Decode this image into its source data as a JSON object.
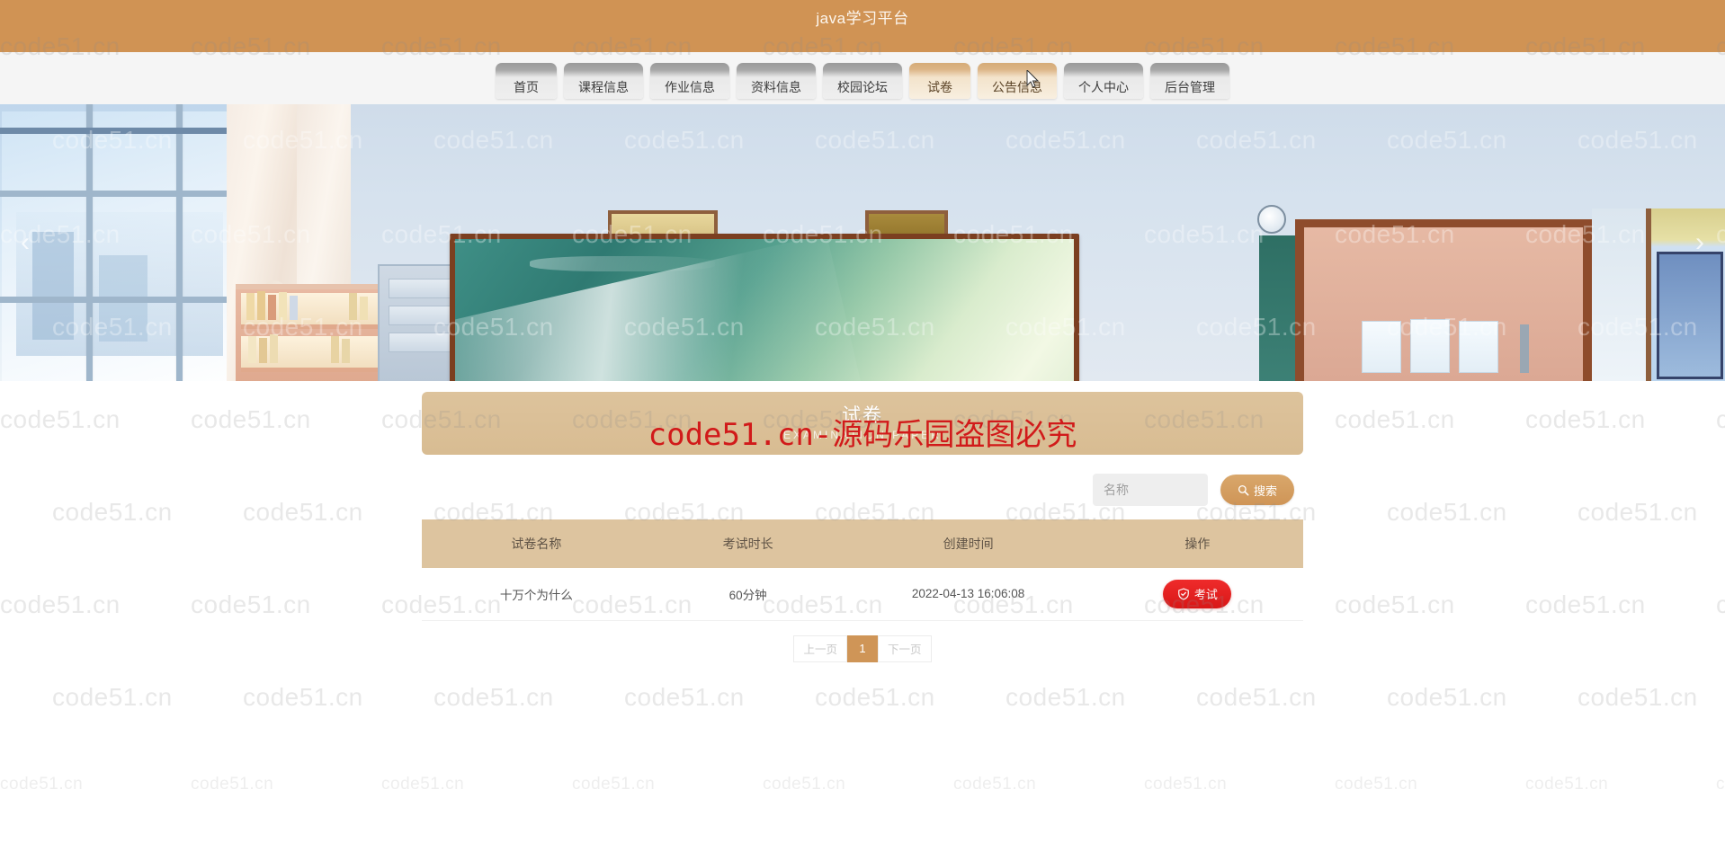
{
  "header": {
    "site_title": "java学习平台",
    "bar_color": "#d09354"
  },
  "nav": {
    "items": [
      {
        "label": "首页",
        "state": "normal"
      },
      {
        "label": "课程信息",
        "state": "normal"
      },
      {
        "label": "作业信息",
        "state": "normal"
      },
      {
        "label": "资料信息",
        "state": "normal"
      },
      {
        "label": "校园论坛",
        "state": "normal"
      },
      {
        "label": "试卷",
        "state": "active"
      },
      {
        "label": "公告信息",
        "state": "hover"
      },
      {
        "label": "个人中心",
        "state": "normal"
      },
      {
        "label": "后台管理",
        "state": "normal"
      }
    ]
  },
  "banner": {
    "prev_arrow": "‹",
    "next_arrow": "›"
  },
  "page": {
    "title": "试卷",
    "subtitle": "EXAMINATION PAPER"
  },
  "search": {
    "placeholder": "名称",
    "value": "",
    "button_label": "搜索",
    "button_color": "#cf9557"
  },
  "table": {
    "columns": [
      "试卷名称",
      "考试时长",
      "创建时间",
      "操作"
    ],
    "rows": [
      {
        "name": "十万个为什么",
        "duration": "60分钟",
        "created": "2022-04-13 16:06:08",
        "action_label": "考试",
        "action_color": "#e01b1b"
      }
    ]
  },
  "pagination": {
    "prev_label": "上一页",
    "current_page": "1",
    "next_label": "下一页",
    "active_color": "#cf9557"
  },
  "watermark": {
    "tile_text": "code51.cn",
    "red_text": "code51.cn-源码乐园盗图必究",
    "red_color": "#d11a1a"
  }
}
